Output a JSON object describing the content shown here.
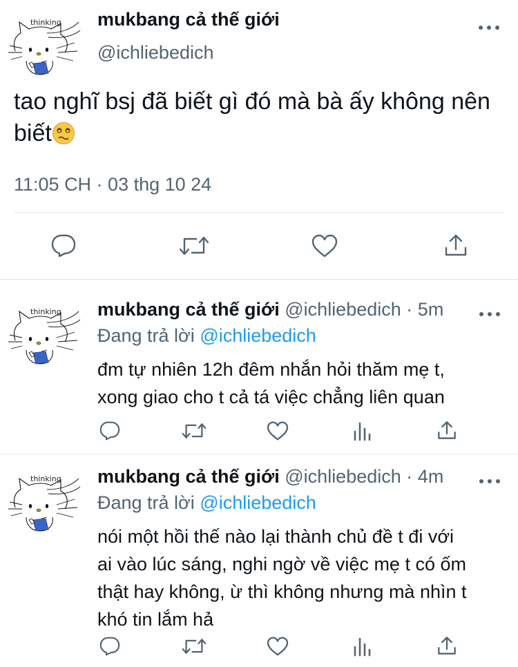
{
  "main_tweet": {
    "avatar_caption": "thinking",
    "display_name": "mukbang cả thế giới",
    "handle": "@ichliebedich",
    "text": "tao nghĩ bsj đã biết gì đó mà bà ấy không nên biết",
    "emoji": "dizzy-face-emoji",
    "timestamp": "11:05 CH · 03 thg 10 24",
    "actions": [
      "reply-icon",
      "retweet-icon",
      "like-icon",
      "share-icon"
    ]
  },
  "replies": [
    {
      "avatar_caption": "thinking",
      "display_name": "mukbang cả thế giới",
      "handle": "@ichliebedich",
      "separator": "·",
      "time": "5m",
      "replying_prefix": "Đang trả lời",
      "replying_to": "@ichliebedich",
      "text_lines": [
        "đm tự nhiên 12h đêm nhắn hỏi thăm mẹ t,",
        "xong giao cho t cả tá việc chẳng liên quan"
      ],
      "actions": [
        "reply-icon",
        "retweet-icon",
        "like-icon",
        "analytics-icon",
        "share-icon"
      ]
    },
    {
      "avatar_caption": "thinking",
      "display_name": "mukbang cả thế giới",
      "handle": "@ichliebedich",
      "separator": "·",
      "time": "4m",
      "replying_prefix": "Đang trả lời",
      "replying_to": "@ichliebedich",
      "text_lines": [
        "nói một hồi thế nào lại thành chủ đề t đi với",
        "ai vào lúc sáng, nghi ngờ về việc mẹ t có ốm",
        "thật hay không, ừ thì không nhưng mà nhìn t",
        "khó tin lắm hả"
      ],
      "actions": [
        "reply-icon",
        "retweet-icon",
        "like-icon",
        "analytics-icon",
        "share-icon"
      ]
    }
  ],
  "colors": {
    "text_primary": "#0f1419",
    "text_secondary": "#536471",
    "link": "#1d9bf0",
    "divider": "#e1e6ea"
  }
}
